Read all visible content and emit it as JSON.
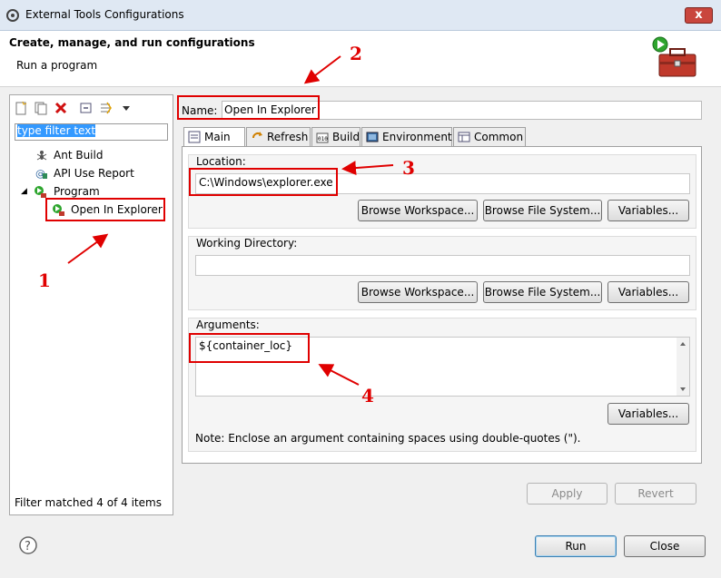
{
  "window": {
    "title": "External Tools Configurations",
    "close_label": "x"
  },
  "header": {
    "title": "Create, manage, and run configurations",
    "subtitle": "Run a program"
  },
  "left": {
    "filter_placeholder": "type filter text",
    "tree": [
      {
        "label": "Ant Build",
        "icon": "ant-icon"
      },
      {
        "label": "API Use Report",
        "icon": "api-icon"
      },
      {
        "label": "Program",
        "icon": "program-icon",
        "expanded": true
      },
      {
        "label": "Open In Explorer",
        "icon": "program-run-icon",
        "selected": true
      }
    ],
    "status": "Filter matched 4 of 4 items",
    "toggle": "◢"
  },
  "config": {
    "name_label": "Name:",
    "name_value": "Open In Explorer",
    "tabs": [
      "Main",
      "Refresh",
      "Build",
      "Environment",
      "Common"
    ],
    "location_label": "Location:",
    "location_value": "C:\\Windows\\explorer.exe",
    "workdir_label": "Working Directory:",
    "workdir_value": "",
    "arguments_label": "Arguments:",
    "arguments_value": "${container_loc}",
    "note": "Note: Enclose an argument containing spaces using double-quotes (\").",
    "browse_workspace": "Browse Workspace...",
    "browse_filesystem": "Browse File System...",
    "variables": "Variables..."
  },
  "buttons": {
    "apply": "Apply",
    "revert": "Revert",
    "run": "Run",
    "close": "Close"
  },
  "annotations": [
    "1",
    "2",
    "3",
    "4"
  ],
  "colors": {
    "annotation": "#e00000",
    "selection": "#3399ff"
  }
}
